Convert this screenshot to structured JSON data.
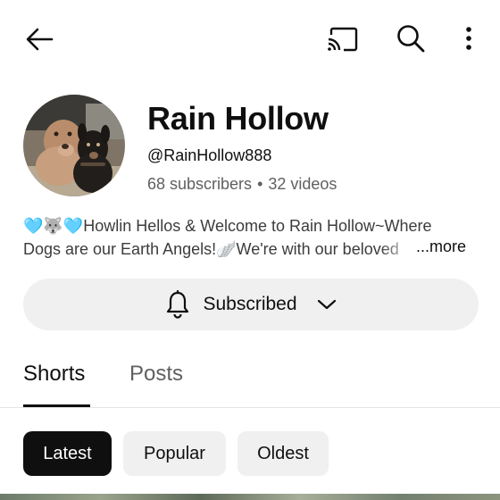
{
  "topbar": {
    "icons": {
      "back": "arrow-left-icon",
      "cast": "cast-icon",
      "search": "search-icon",
      "more": "more-vertical-icon"
    }
  },
  "channel": {
    "name": "Rain Hollow",
    "handle": "@RainHollow888",
    "subscribers": "68 subscribers",
    "separator": "•",
    "videos": "32 videos",
    "description_line1": "🩵🐺🩵Howlin Hellos & Welcome to Rain Hollow~Where",
    "description_line2": "Dogs are our Earth Angels!🪽We're with our beloved",
    "more_label": "...more"
  },
  "subscribe_button": {
    "label": "Subscribed",
    "icons": {
      "bell": "bell-icon",
      "chevron": "chevron-down-icon"
    }
  },
  "tabs": [
    {
      "label": "Shorts",
      "active": true
    },
    {
      "label": "Posts",
      "active": false
    }
  ],
  "filter_chips": [
    {
      "label": "Latest",
      "selected": true
    },
    {
      "label": "Popular",
      "selected": false
    },
    {
      "label": "Oldest",
      "selected": false
    }
  ],
  "colors": {
    "text_primary": "#0f0f0f",
    "text_secondary": "#606060",
    "chip_bg": "#f0f0f0",
    "chip_selected_bg": "#0f0f0f"
  }
}
